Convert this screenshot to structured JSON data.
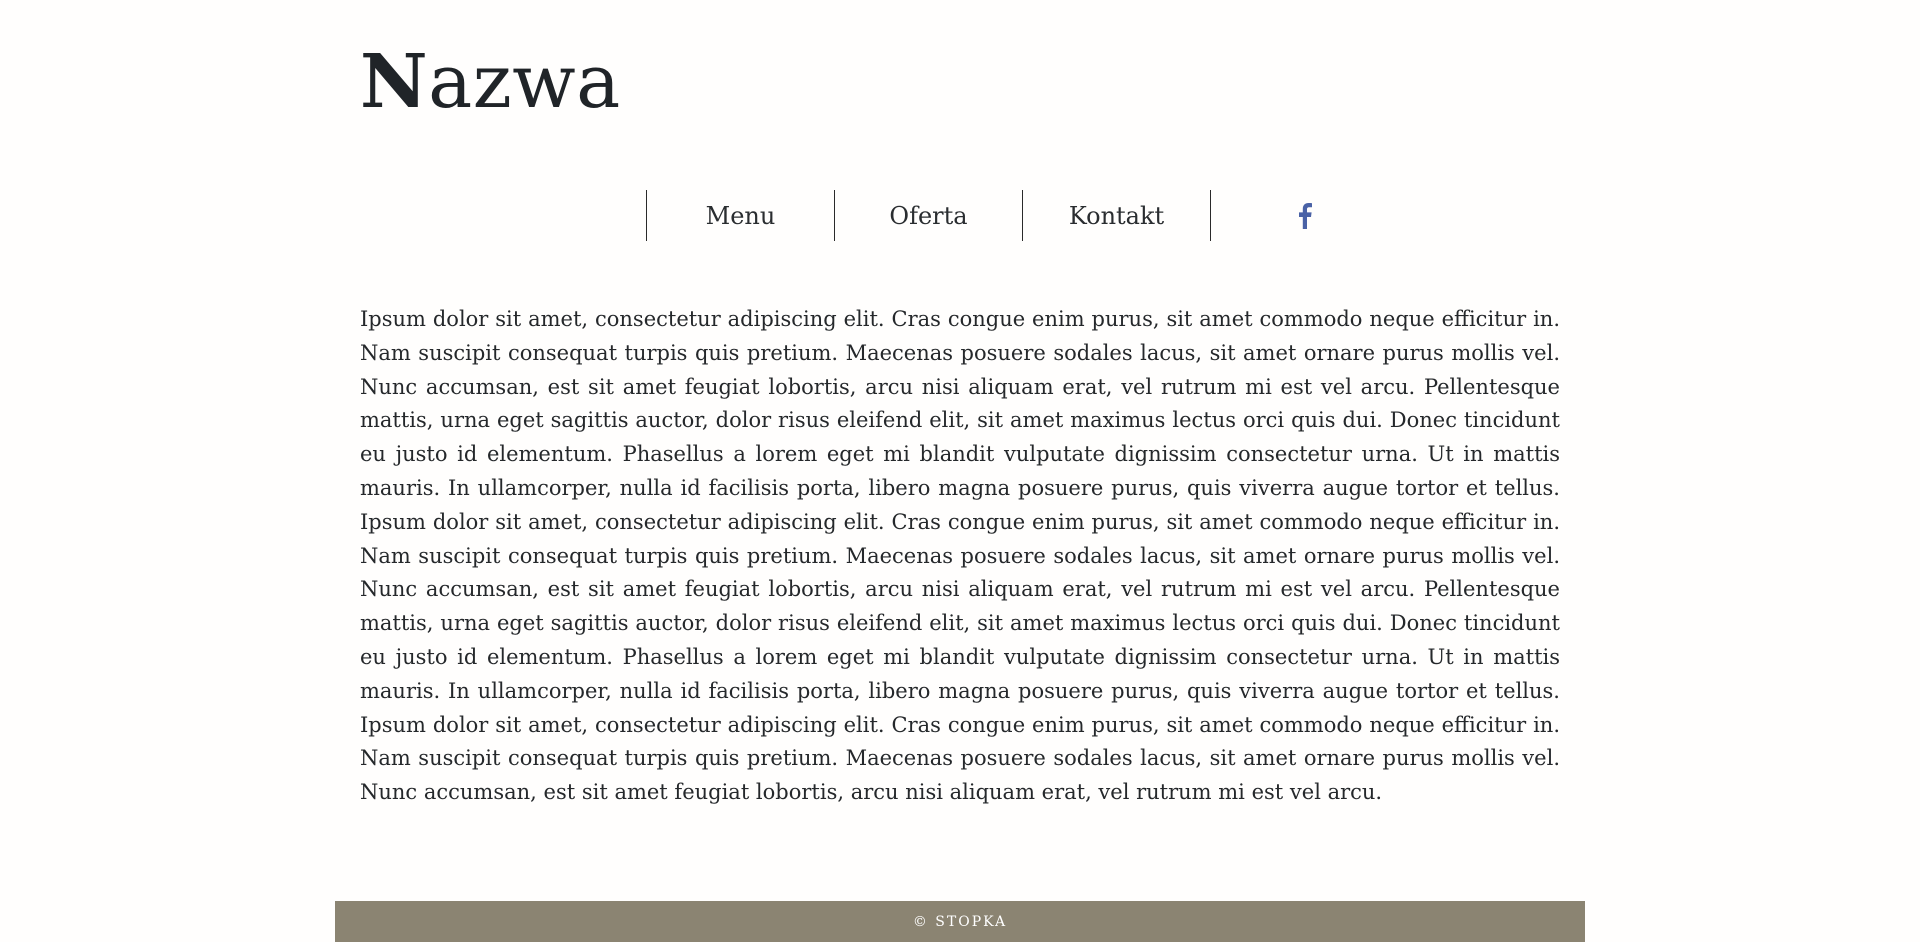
{
  "header": {
    "title_first": "N",
    "title_rest": "azwa"
  },
  "nav": {
    "items": [
      {
        "label": "Menu"
      },
      {
        "label": "Oferta"
      },
      {
        "label": "Kontakt"
      }
    ],
    "social_icon": "facebook-icon",
    "social_color": "#4a62a6"
  },
  "content": {
    "text": "Ipsum dolor sit amet, consectetur adipiscing elit. Cras congue enim purus, sit amet commodo neque efficitur in. Nam suscipit consequat turpis quis pretium. Maecenas posuere sodales lacus, sit amet ornare purus mollis vel. Nunc accumsan, est sit amet feugiat lobortis, arcu nisi aliquam erat, vel rutrum mi est vel arcu. Pellentesque mattis, urna eget sagittis auctor, dolor risus eleifend elit, sit amet maximus lectus orci quis dui. Donec tincidunt eu justo id elementum. Phasellus a lorem eget mi blandit vulputate dignissim consectetur urna. Ut in mattis mauris. In ullamcorper, nulla id facilisis porta, libero magna posuere purus, quis viverra augue tortor et tellus. Ipsum dolor sit amet, consectetur adipiscing elit. Cras congue enim purus, sit amet commodo neque efficitur in. Nam suscipit consequat turpis quis pretium. Maecenas posuere sodales lacus, sit amet ornare purus mollis vel. Nunc accumsan, est sit amet feugiat lobortis, arcu nisi aliquam erat, vel rutrum mi est vel arcu. Pellentesque mattis, urna eget sagittis auctor, dolor risus eleifend elit, sit amet maximus lectus orci quis dui. Donec tincidunt eu justo id elementum. Phasellus a lorem eget mi blandit vulputate dignissim consectetur urna. Ut in mattis mauris. In ullamcorper, nulla id facilisis porta, libero magna posuere purus, quis viverra augue tortor et tellus. Ipsum dolor sit amet, consectetur adipiscing elit. Cras congue enim purus, sit amet commodo neque efficitur in. Nam suscipit consequat turpis quis pretium. Maecenas posuere sodales lacus, sit amet ornare purus mollis vel. Nunc accumsan, est sit amet feugiat lobortis, arcu nisi aliquam erat, vel rutrum mi est vel arcu."
  },
  "footer": {
    "text": "© STOPKA",
    "background": "#8b8472"
  }
}
